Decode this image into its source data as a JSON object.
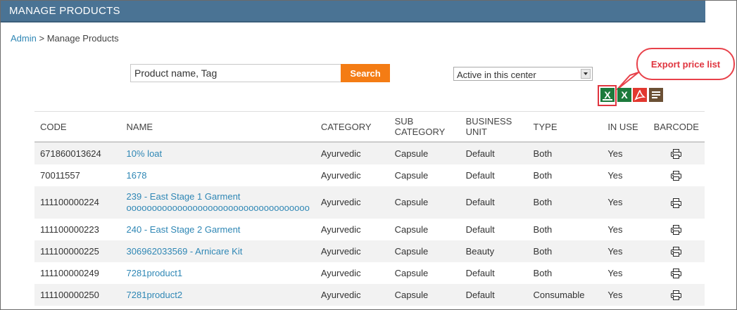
{
  "header": {
    "title": "MANAGE PRODUCTS"
  },
  "breadcrumb": {
    "root": "Admin",
    "separator": ">",
    "current": "Manage Products"
  },
  "search": {
    "value": "Product name, Tag",
    "button_label": "Search"
  },
  "filter": {
    "selected": "Active in this center"
  },
  "callout": {
    "text": "Export price list",
    "color": "#e0353f"
  },
  "export_icons": [
    "excel-price-list-icon",
    "excel-icon",
    "pdf-icon",
    "text-report-icon"
  ],
  "accent": {
    "header": "#4a7394",
    "search_button": "#f47c14",
    "link": "#2f87b5"
  },
  "table": {
    "columns": [
      "CODE",
      "NAME",
      "CATEGORY",
      "SUB CATEGORY",
      "BUSINESS UNIT",
      "TYPE",
      "IN USE",
      "BARCODE"
    ],
    "rows": [
      {
        "code": "671860013624",
        "name": "10% loat",
        "category": "Ayurvedic",
        "sub_category": "Capsule",
        "business_unit": "Default",
        "type": "Both",
        "in_use": "Yes"
      },
      {
        "code": "70011557",
        "name": "1678",
        "category": "Ayurvedic",
        "sub_category": "Capsule",
        "business_unit": "Default",
        "type": "Both",
        "in_use": "Yes"
      },
      {
        "code": "111100000224",
        "name": "239 - East Stage 1 Garment",
        "name_line2": "oooooooooooooooooooooooooooooooooooo",
        "category": "Ayurvedic",
        "sub_category": "Capsule",
        "business_unit": "Default",
        "type": "Both",
        "in_use": "Yes"
      },
      {
        "code": "111100000223",
        "name": "240 - East Stage 2 Garment",
        "category": "Ayurvedic",
        "sub_category": "Capsule",
        "business_unit": "Default",
        "type": "Both",
        "in_use": "Yes"
      },
      {
        "code": "111100000225",
        "name": "306962033569 - Arnicare Kit",
        "category": "Ayurvedic",
        "sub_category": "Capsule",
        "business_unit": "Beauty",
        "type": "Both",
        "in_use": "Yes"
      },
      {
        "code": "111100000249",
        "name": "7281product1",
        "category": "Ayurvedic",
        "sub_category": "Capsule",
        "business_unit": "Default",
        "type": "Both",
        "in_use": "Yes"
      },
      {
        "code": "111100000250",
        "name": "7281product2",
        "category": "Ayurvedic",
        "sub_category": "Capsule",
        "business_unit": "Default",
        "type": "Consumable",
        "in_use": "Yes"
      }
    ]
  }
}
